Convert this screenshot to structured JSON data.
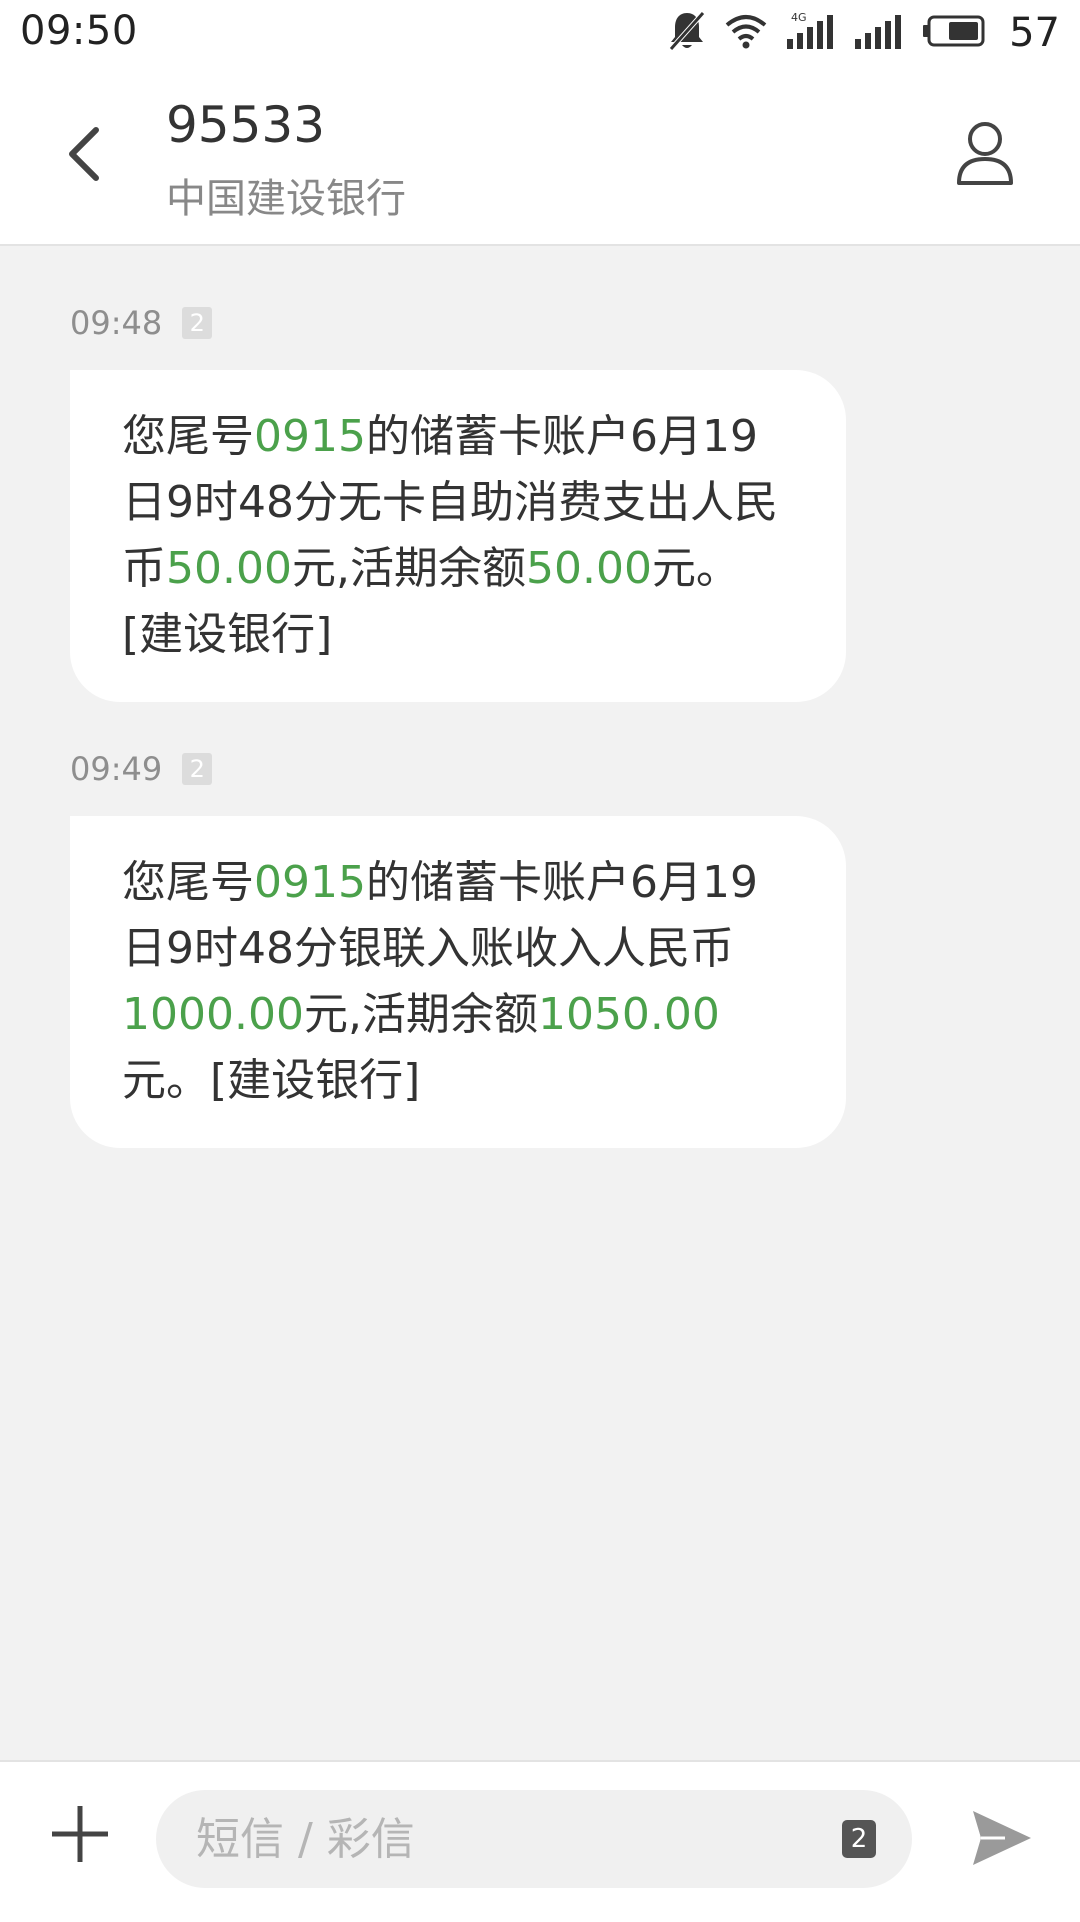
{
  "status_bar": {
    "time": "09:50",
    "battery": "57",
    "network": "4G",
    "icons": [
      "bell-off-icon",
      "wifi-icon",
      "signal-4g-icon",
      "signal-icon",
      "battery-icon"
    ]
  },
  "header": {
    "title": "95533",
    "subtitle": "中国建设银行",
    "back_icon": "chevron-left-icon",
    "contact_icon": "person-icon"
  },
  "messages": [
    {
      "time": "09:48",
      "sim": "2",
      "parts": [
        {
          "text": "您尾号",
          "hl": false
        },
        {
          "text": "0915",
          "hl": true
        },
        {
          "text": "的储蓄卡账户6月19日9时48分无卡自助消费支出人民币",
          "hl": false
        },
        {
          "text": "50.00",
          "hl": true
        },
        {
          "text": "元,活期余额",
          "hl": false
        },
        {
          "text": "50.00",
          "hl": true
        },
        {
          "text": "元。[建设银行]",
          "hl": false
        }
      ]
    },
    {
      "time": "09:49",
      "sim": "2",
      "parts": [
        {
          "text": "您尾号",
          "hl": false
        },
        {
          "text": "0915",
          "hl": true
        },
        {
          "text": "的储蓄卡账户6月19日9时48分银联入账收入人民币",
          "hl": false
        },
        {
          "text": "1000.00",
          "hl": true
        },
        {
          "text": "元,活期余额",
          "hl": false
        },
        {
          "text": "1050.00",
          "hl": true
        },
        {
          "text": "元。[建设银行]",
          "hl": false
        }
      ]
    }
  ],
  "composer": {
    "placeholder": "短信 / 彩信",
    "sim": "2",
    "add_icon": "plus-icon",
    "send_icon": "send-icon"
  },
  "colors": {
    "highlight": "#4ba14b",
    "background": "#f2f2f2",
    "bubble": "#ffffff"
  }
}
